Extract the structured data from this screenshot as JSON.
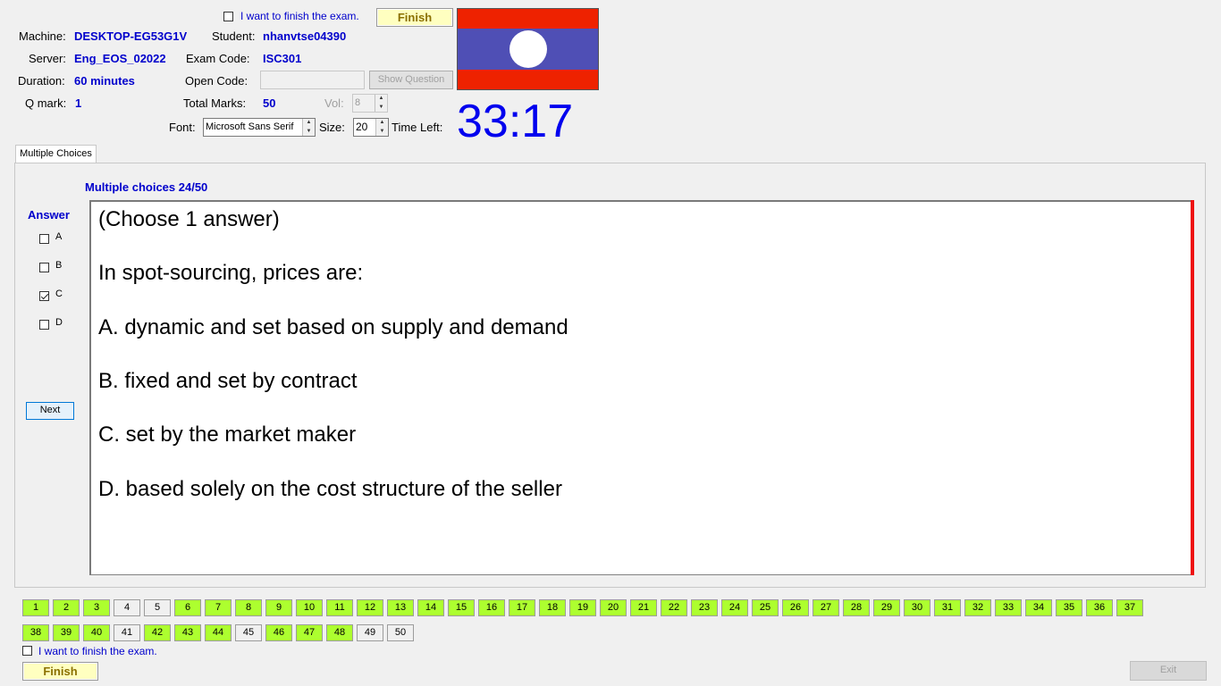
{
  "header": {
    "finish_check_label": "I want to finish the exam.",
    "finish_button": "Finish",
    "machine_label": "Machine:",
    "machine_value": "DESKTOP-EG53G1V",
    "student_label": "Student:",
    "student_value": "nhanvtse04390",
    "server_label": "Server:",
    "server_value": "Eng_EOS_02022",
    "exam_code_label": "Exam Code:",
    "exam_code_value": "ISC301",
    "duration_label": "Duration:",
    "duration_value": "60 minutes",
    "open_code_label": "Open Code:",
    "open_code_value": "",
    "show_question_button": "Show Question",
    "qmark_label": "Q mark:",
    "qmark_value": "1",
    "total_marks_label": "Total Marks:",
    "total_marks_value": "50",
    "vol_label": "Vol:",
    "vol_value": "8",
    "font_label": "Font:",
    "font_value": "Microsoft Sans Serif",
    "size_label": "Size:",
    "size_value": "20",
    "time_left_label": "Time Left:",
    "time_left_value": "33:17",
    "flag": {
      "red": "#ee2200",
      "blue": "#4f4fb5",
      "white": "#ffffff"
    }
  },
  "tab": {
    "label": "Multiple Choices"
  },
  "question": {
    "progress": "Multiple choices 24/50",
    "answer_label": "Answer",
    "options": [
      {
        "letter": "A",
        "checked": false
      },
      {
        "letter": "B",
        "checked": false
      },
      {
        "letter": "C",
        "checked": true
      },
      {
        "letter": "D",
        "checked": false
      }
    ],
    "next_button": "Next",
    "lines": [
      "(Choose 1 answer)",
      "In spot-sourcing, prices are:",
      "A.  dynamic and set based on supply and demand",
      "B.  fixed and set by contract",
      "C.  set by the market maker",
      "D.  based solely on the cost structure of the seller"
    ]
  },
  "navigator": {
    "buttons": [
      {
        "n": "1",
        "done": true
      },
      {
        "n": "2",
        "done": true
      },
      {
        "n": "3",
        "done": true
      },
      {
        "n": "4",
        "done": false
      },
      {
        "n": "5",
        "done": false
      },
      {
        "n": "6",
        "done": true
      },
      {
        "n": "7",
        "done": true
      },
      {
        "n": "8",
        "done": true
      },
      {
        "n": "9",
        "done": true
      },
      {
        "n": "10",
        "done": true
      },
      {
        "n": "11",
        "done": true
      },
      {
        "n": "12",
        "done": true
      },
      {
        "n": "13",
        "done": true
      },
      {
        "n": "14",
        "done": true
      },
      {
        "n": "15",
        "done": true
      },
      {
        "n": "16",
        "done": true
      },
      {
        "n": "17",
        "done": true
      },
      {
        "n": "18",
        "done": true
      },
      {
        "n": "19",
        "done": true
      },
      {
        "n": "20",
        "done": true
      },
      {
        "n": "21",
        "done": true
      },
      {
        "n": "22",
        "done": true
      },
      {
        "n": "23",
        "done": true
      },
      {
        "n": "24",
        "done": true
      },
      {
        "n": "25",
        "done": true
      },
      {
        "n": "26",
        "done": true
      },
      {
        "n": "27",
        "done": true
      },
      {
        "n": "28",
        "done": true
      },
      {
        "n": "29",
        "done": true
      },
      {
        "n": "30",
        "done": true
      },
      {
        "n": "31",
        "done": true
      },
      {
        "n": "32",
        "done": true
      },
      {
        "n": "33",
        "done": true
      },
      {
        "n": "34",
        "done": true
      },
      {
        "n": "35",
        "done": true
      },
      {
        "n": "36",
        "done": true
      },
      {
        "n": "37",
        "done": true
      },
      {
        "n": "38",
        "done": true
      },
      {
        "n": "39",
        "done": true
      },
      {
        "n": "40",
        "done": true
      },
      {
        "n": "41",
        "done": false
      },
      {
        "n": "42",
        "done": true
      },
      {
        "n": "43",
        "done": true
      },
      {
        "n": "44",
        "done": true
      },
      {
        "n": "45",
        "done": false
      },
      {
        "n": "46",
        "done": true
      },
      {
        "n": "47",
        "done": true
      },
      {
        "n": "48",
        "done": true
      },
      {
        "n": "49",
        "done": false
      },
      {
        "n": "50",
        "done": false
      }
    ]
  },
  "footer": {
    "finish_check_label": "I want to finish the exam.",
    "finish_button": "Finish",
    "exit_button": "Exit"
  }
}
